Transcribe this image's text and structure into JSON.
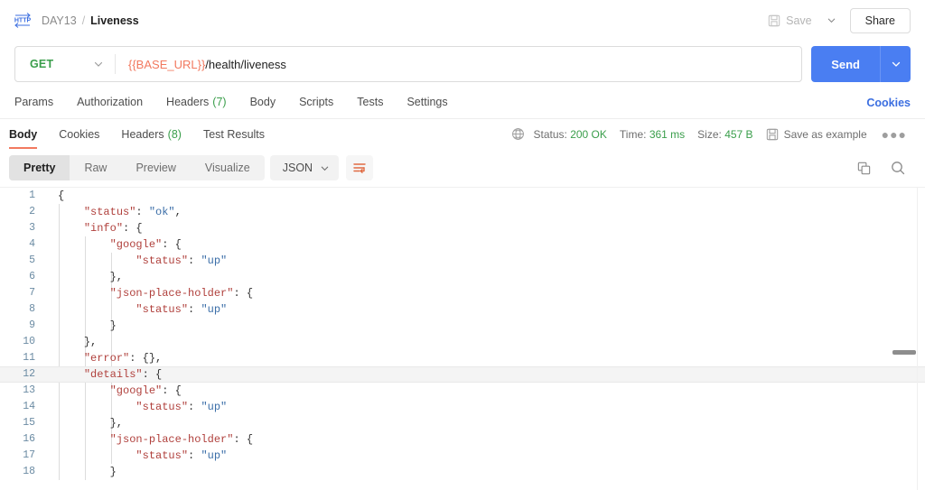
{
  "header": {
    "protocol_icon": "http-icon",
    "collection": "DAY13",
    "separator": "/",
    "request_name": "Liveness",
    "save_label": "Save",
    "save_icon": "floppy-disk-icon",
    "save_caret_icon": "chevron-down-icon",
    "share_label": "Share"
  },
  "url_bar": {
    "method": "GET",
    "method_caret_icon": "chevron-down-icon",
    "url_variable": "{{BASE_URL}}",
    "url_path": "/health/liveness",
    "send_label": "Send",
    "send_caret_icon": "chevron-down-icon"
  },
  "request_tabs": {
    "items": [
      {
        "label": "Params",
        "count": "",
        "active": false
      },
      {
        "label": "Authorization",
        "count": "",
        "active": false
      },
      {
        "label": "Headers",
        "count": "(7)",
        "active": false
      },
      {
        "label": "Body",
        "count": "",
        "active": false
      },
      {
        "label": "Scripts",
        "count": "",
        "active": false
      },
      {
        "label": "Tests",
        "count": "",
        "active": false
      },
      {
        "label": "Settings",
        "count": "",
        "active": false
      }
    ],
    "cookies_link": "Cookies"
  },
  "response": {
    "tabs": [
      {
        "label": "Body",
        "count": "",
        "active": true
      },
      {
        "label": "Cookies",
        "count": "",
        "active": false
      },
      {
        "label": "Headers",
        "count": "(8)",
        "active": false
      },
      {
        "label": "Test Results",
        "count": "",
        "active": false
      }
    ],
    "globe_icon": "globe-icon",
    "status_label": "Status:",
    "status_value": "200 OK",
    "time_label": "Time:",
    "time_value": "361 ms",
    "size_label": "Size:",
    "size_value": "457 B",
    "save_example_icon": "floppy-disk-icon",
    "save_example_label": "Save as example",
    "more_icon": "ellipsis-icon"
  },
  "format_bar": {
    "segments": [
      {
        "label": "Pretty",
        "active": true
      },
      {
        "label": "Raw",
        "active": false
      },
      {
        "label": "Preview",
        "active": false
      },
      {
        "label": "Visualize",
        "active": false
      }
    ],
    "language": "JSON",
    "language_caret_icon": "chevron-down-icon",
    "wrap_icon": "word-wrap-icon",
    "copy_icon": "copy-icon",
    "search_icon": "search-icon"
  },
  "body": {
    "highlighted_line": 12,
    "lines": [
      {
        "n": 1,
        "indent": 0,
        "tokens": [
          {
            "t": "p",
            "v": "{"
          }
        ]
      },
      {
        "n": 2,
        "indent": 1,
        "tokens": [
          {
            "t": "k",
            "v": "\"status\""
          },
          {
            "t": "p",
            "v": ": "
          },
          {
            "t": "s",
            "v": "\"ok\""
          },
          {
            "t": "p",
            "v": ","
          }
        ]
      },
      {
        "n": 3,
        "indent": 1,
        "tokens": [
          {
            "t": "k",
            "v": "\"info\""
          },
          {
            "t": "p",
            "v": ": {"
          }
        ]
      },
      {
        "n": 4,
        "indent": 2,
        "tokens": [
          {
            "t": "k",
            "v": "\"google\""
          },
          {
            "t": "p",
            "v": ": {"
          }
        ]
      },
      {
        "n": 5,
        "indent": 3,
        "tokens": [
          {
            "t": "k",
            "v": "\"status\""
          },
          {
            "t": "p",
            "v": ": "
          },
          {
            "t": "s",
            "v": "\"up\""
          }
        ]
      },
      {
        "n": 6,
        "indent": 2,
        "tokens": [
          {
            "t": "p",
            "v": "},"
          }
        ]
      },
      {
        "n": 7,
        "indent": 2,
        "tokens": [
          {
            "t": "k",
            "v": "\"json-place-holder\""
          },
          {
            "t": "p",
            "v": ": {"
          }
        ]
      },
      {
        "n": 8,
        "indent": 3,
        "tokens": [
          {
            "t": "k",
            "v": "\"status\""
          },
          {
            "t": "p",
            "v": ": "
          },
          {
            "t": "s",
            "v": "\"up\""
          }
        ]
      },
      {
        "n": 9,
        "indent": 2,
        "tokens": [
          {
            "t": "p",
            "v": "}"
          }
        ]
      },
      {
        "n": 10,
        "indent": 1,
        "tokens": [
          {
            "t": "p",
            "v": "},"
          }
        ]
      },
      {
        "n": 11,
        "indent": 1,
        "tokens": [
          {
            "t": "k",
            "v": "\"error\""
          },
          {
            "t": "p",
            "v": ": {},"
          }
        ]
      },
      {
        "n": 12,
        "indent": 1,
        "tokens": [
          {
            "t": "k",
            "v": "\"details\""
          },
          {
            "t": "p",
            "v": ": {"
          }
        ]
      },
      {
        "n": 13,
        "indent": 2,
        "tokens": [
          {
            "t": "k",
            "v": "\"google\""
          },
          {
            "t": "p",
            "v": ": {"
          }
        ]
      },
      {
        "n": 14,
        "indent": 3,
        "tokens": [
          {
            "t": "k",
            "v": "\"status\""
          },
          {
            "t": "p",
            "v": ": "
          },
          {
            "t": "s",
            "v": "\"up\""
          }
        ]
      },
      {
        "n": 15,
        "indent": 2,
        "tokens": [
          {
            "t": "p",
            "v": "},"
          }
        ]
      },
      {
        "n": 16,
        "indent": 2,
        "tokens": [
          {
            "t": "k",
            "v": "\"json-place-holder\""
          },
          {
            "t": "p",
            "v": ": {"
          }
        ]
      },
      {
        "n": 17,
        "indent": 3,
        "tokens": [
          {
            "t": "k",
            "v": "\"status\""
          },
          {
            "t": "p",
            "v": ": "
          },
          {
            "t": "s",
            "v": "\"up\""
          }
        ]
      },
      {
        "n": 18,
        "indent": 2,
        "tokens": [
          {
            "t": "p",
            "v": "}"
          }
        ]
      }
    ]
  }
}
